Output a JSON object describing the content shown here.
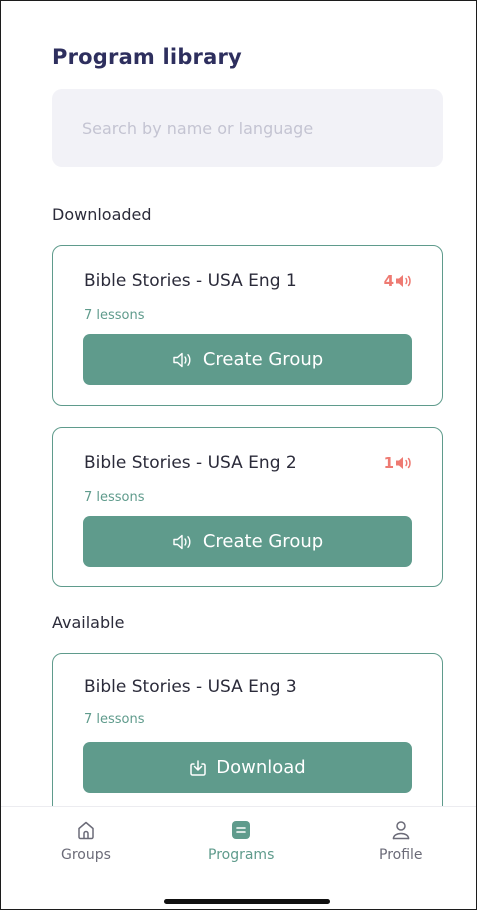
{
  "header": {
    "title": "Program library"
  },
  "search": {
    "placeholder": "Search by name or language"
  },
  "sections": {
    "downloaded_label": "Downloaded",
    "available_label": "Available"
  },
  "downloaded": [
    {
      "title": "Bible Stories - USA Eng 1",
      "lessons": "7 lessons",
      "badge_count": "4",
      "button_label": "Create Group",
      "button_icon": "speaker-icon"
    },
    {
      "title": "Bible Stories - USA Eng 2",
      "lessons": "7 lessons",
      "badge_count": "1",
      "button_label": "Create Group",
      "button_icon": "speaker-icon"
    }
  ],
  "available": [
    {
      "title": "Bible Stories - USA Eng 3",
      "lessons": "7 lessons",
      "button_label": "Download",
      "button_icon": "download-icon"
    }
  ],
  "tabbar": {
    "tabs": [
      {
        "label": "Groups",
        "icon": "home-icon",
        "active": false
      },
      {
        "label": "Programs",
        "icon": "programs-icon",
        "active": true
      },
      {
        "label": "Profile",
        "icon": "profile-icon",
        "active": false
      }
    ]
  },
  "colors": {
    "accent": "#5f9b8c",
    "title": "#2e2f5e",
    "badge": "#ee7a72",
    "search_bg": "#f2f2f7"
  }
}
